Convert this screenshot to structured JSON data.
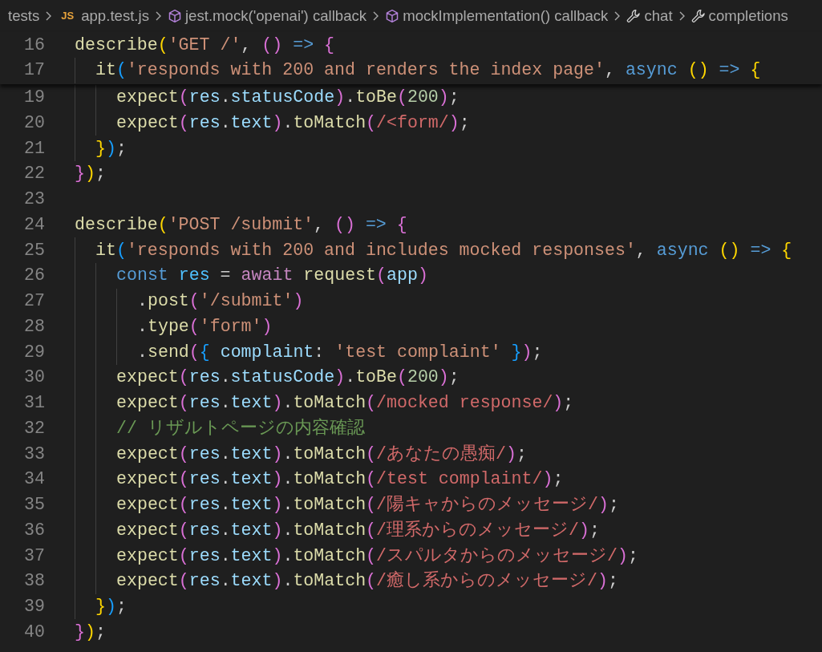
{
  "breadcrumbs": [
    {
      "kind": "folder",
      "label": "tests"
    },
    {
      "kind": "file",
      "badge": "JS",
      "label": "app.test.js"
    },
    {
      "kind": "function",
      "label": "jest.mock('openai') callback"
    },
    {
      "kind": "function",
      "label": "mockImplementation() callback"
    },
    {
      "kind": "property",
      "label": "chat"
    },
    {
      "kind": "property",
      "label": "completions"
    }
  ],
  "sticky_lines": [
    {
      "number": "16",
      "tokens": [
        {
          "kind": "fn",
          "text": "describe"
        },
        {
          "kind": "b1",
          "text": "("
        },
        {
          "kind": "str",
          "text": "'GET /'"
        },
        {
          "kind": "p",
          "text": ", "
        },
        {
          "kind": "b2",
          "text": "() "
        },
        {
          "kind": "kw",
          "text": "=> "
        },
        {
          "kind": "b2",
          "text": "{"
        }
      ]
    },
    {
      "number": "17",
      "tokens": [
        {
          "kind": "fn",
          "text": "  it"
        },
        {
          "kind": "b3",
          "text": "("
        },
        {
          "kind": "str",
          "text": "'responds with 200 and renders the index page'"
        },
        {
          "kind": "p",
          "text": ", "
        },
        {
          "kind": "kw",
          "text": "async "
        },
        {
          "kind": "b1",
          "text": "() "
        },
        {
          "kind": "kw",
          "text": "=> "
        },
        {
          "kind": "b1",
          "text": "{"
        }
      ]
    }
  ],
  "lines": [
    {
      "number": "19",
      "tokens": [
        {
          "kind": "fn",
          "text": "    expect"
        },
        {
          "kind": "b2",
          "text": "("
        },
        {
          "kind": "var",
          "text": "res"
        },
        {
          "kind": "p",
          "text": "."
        },
        {
          "kind": "var",
          "text": "statusCode"
        },
        {
          "kind": "b2",
          "text": ")"
        },
        {
          "kind": "p",
          "text": "."
        },
        {
          "kind": "fn",
          "text": "toBe"
        },
        {
          "kind": "b2",
          "text": "("
        },
        {
          "kind": "num",
          "text": "200"
        },
        {
          "kind": "b2",
          "text": ")"
        },
        {
          "kind": "p",
          "text": ";"
        }
      ]
    },
    {
      "number": "20",
      "tokens": [
        {
          "kind": "fn",
          "text": "    expect"
        },
        {
          "kind": "b2",
          "text": "("
        },
        {
          "kind": "var",
          "text": "res"
        },
        {
          "kind": "p",
          "text": "."
        },
        {
          "kind": "var",
          "text": "text"
        },
        {
          "kind": "b2",
          "text": ")"
        },
        {
          "kind": "p",
          "text": "."
        },
        {
          "kind": "fn",
          "text": "toMatch"
        },
        {
          "kind": "b2",
          "text": "("
        },
        {
          "kind": "re",
          "text": "/<form/"
        },
        {
          "kind": "b2",
          "text": ")"
        },
        {
          "kind": "p",
          "text": ";"
        }
      ]
    },
    {
      "number": "21",
      "tokens": [
        {
          "kind": "b1",
          "text": "  }"
        },
        {
          "kind": "b3",
          "text": ")"
        },
        {
          "kind": "p",
          "text": ";"
        }
      ]
    },
    {
      "number": "22",
      "tokens": [
        {
          "kind": "b2",
          "text": "}"
        },
        {
          "kind": "b1",
          "text": ")"
        },
        {
          "kind": "p",
          "text": ";"
        }
      ]
    },
    {
      "number": "23"
    },
    {
      "number": "24",
      "tokens": [
        {
          "kind": "fn",
          "text": "describe"
        },
        {
          "kind": "b1",
          "text": "("
        },
        {
          "kind": "str",
          "text": "'POST /submit'"
        },
        {
          "kind": "p",
          "text": ", "
        },
        {
          "kind": "b2",
          "text": "() "
        },
        {
          "kind": "kw",
          "text": "=> "
        },
        {
          "kind": "b2",
          "text": "{"
        }
      ]
    },
    {
      "number": "25",
      "tokens": [
        {
          "kind": "fn",
          "text": "  it"
        },
        {
          "kind": "b3",
          "text": "("
        },
        {
          "kind": "str",
          "text": "'responds with 200 and includes mocked responses'"
        },
        {
          "kind": "p",
          "text": ", "
        },
        {
          "kind": "kw",
          "text": "async "
        },
        {
          "kind": "b1",
          "text": "() "
        },
        {
          "kind": "kw",
          "text": "=> "
        },
        {
          "kind": "b1",
          "text": "{"
        }
      ]
    },
    {
      "number": "26",
      "tokens": [
        {
          "kind": "kw",
          "text": "    const "
        },
        {
          "kind": "const",
          "text": "res"
        },
        {
          "kind": "p",
          "text": " = "
        },
        {
          "kind": "ctrl",
          "text": "await "
        },
        {
          "kind": "fn",
          "text": "request"
        },
        {
          "kind": "b2",
          "text": "("
        },
        {
          "kind": "var",
          "text": "app"
        },
        {
          "kind": "b2",
          "text": ")"
        }
      ]
    },
    {
      "number": "27",
      "tokens": [
        {
          "kind": "p",
          "text": "      ."
        },
        {
          "kind": "fn",
          "text": "post"
        },
        {
          "kind": "b2",
          "text": "("
        },
        {
          "kind": "str",
          "text": "'/submit'"
        },
        {
          "kind": "b2",
          "text": ")"
        }
      ]
    },
    {
      "number": "28",
      "tokens": [
        {
          "kind": "p",
          "text": "      ."
        },
        {
          "kind": "fn",
          "text": "type"
        },
        {
          "kind": "b2",
          "text": "("
        },
        {
          "kind": "str",
          "text": "'form'"
        },
        {
          "kind": "b2",
          "text": ")"
        }
      ]
    },
    {
      "number": "29",
      "tokens": [
        {
          "kind": "p",
          "text": "      ."
        },
        {
          "kind": "fn",
          "text": "send"
        },
        {
          "kind": "b2",
          "text": "("
        },
        {
          "kind": "b3",
          "text": "{ "
        },
        {
          "kind": "var",
          "text": "complaint"
        },
        {
          "kind": "p",
          "text": ": "
        },
        {
          "kind": "str",
          "text": "'test complaint' "
        },
        {
          "kind": "b3",
          "text": "}"
        },
        {
          "kind": "b2",
          "text": ")"
        },
        {
          "kind": "p",
          "text": ";"
        }
      ]
    },
    {
      "number": "30",
      "tokens": [
        {
          "kind": "fn",
          "text": "    expect"
        },
        {
          "kind": "b2",
          "text": "("
        },
        {
          "kind": "var",
          "text": "res"
        },
        {
          "kind": "p",
          "text": "."
        },
        {
          "kind": "var",
          "text": "statusCode"
        },
        {
          "kind": "b2",
          "text": ")"
        },
        {
          "kind": "p",
          "text": "."
        },
        {
          "kind": "fn",
          "text": "toBe"
        },
        {
          "kind": "b2",
          "text": "("
        },
        {
          "kind": "num",
          "text": "200"
        },
        {
          "kind": "b2",
          "text": ")"
        },
        {
          "kind": "p",
          "text": ";"
        }
      ]
    },
    {
      "number": "31",
      "tokens": [
        {
          "kind": "fn",
          "text": "    expect"
        },
        {
          "kind": "b2",
          "text": "("
        },
        {
          "kind": "var",
          "text": "res"
        },
        {
          "kind": "p",
          "text": "."
        },
        {
          "kind": "var",
          "text": "text"
        },
        {
          "kind": "b2",
          "text": ")"
        },
        {
          "kind": "p",
          "text": "."
        },
        {
          "kind": "fn",
          "text": "toMatch"
        },
        {
          "kind": "b2",
          "text": "("
        },
        {
          "kind": "re",
          "text": "/mocked response/"
        },
        {
          "kind": "b2",
          "text": ")"
        },
        {
          "kind": "p",
          "text": ";"
        }
      ]
    },
    {
      "number": "32",
      "tokens": [
        {
          "kind": "cmt",
          "text": "    // リザルトページの内容確認"
        }
      ]
    },
    {
      "number": "33",
      "tokens": [
        {
          "kind": "fn",
          "text": "    expect"
        },
        {
          "kind": "b2",
          "text": "("
        },
        {
          "kind": "var",
          "text": "res"
        },
        {
          "kind": "p",
          "text": "."
        },
        {
          "kind": "var",
          "text": "text"
        },
        {
          "kind": "b2",
          "text": ")"
        },
        {
          "kind": "p",
          "text": "."
        },
        {
          "kind": "fn",
          "text": "toMatch"
        },
        {
          "kind": "b2",
          "text": "("
        },
        {
          "kind": "re",
          "text": "/あなたの愚痴/"
        },
        {
          "kind": "b2",
          "text": ")"
        },
        {
          "kind": "p",
          "text": ";"
        }
      ]
    },
    {
      "number": "34",
      "tokens": [
        {
          "kind": "fn",
          "text": "    expect"
        },
        {
          "kind": "b2",
          "text": "("
        },
        {
          "kind": "var",
          "text": "res"
        },
        {
          "kind": "p",
          "text": "."
        },
        {
          "kind": "var",
          "text": "text"
        },
        {
          "kind": "b2",
          "text": ")"
        },
        {
          "kind": "p",
          "text": "."
        },
        {
          "kind": "fn",
          "text": "toMatch"
        },
        {
          "kind": "b2",
          "text": "("
        },
        {
          "kind": "re",
          "text": "/test complaint/"
        },
        {
          "kind": "b2",
          "text": ")"
        },
        {
          "kind": "p",
          "text": ";"
        }
      ]
    },
    {
      "number": "35",
      "tokens": [
        {
          "kind": "fn",
          "text": "    expect"
        },
        {
          "kind": "b2",
          "text": "("
        },
        {
          "kind": "var",
          "text": "res"
        },
        {
          "kind": "p",
          "text": "."
        },
        {
          "kind": "var",
          "text": "text"
        },
        {
          "kind": "b2",
          "text": ")"
        },
        {
          "kind": "p",
          "text": "."
        },
        {
          "kind": "fn",
          "text": "toMatch"
        },
        {
          "kind": "b2",
          "text": "("
        },
        {
          "kind": "re",
          "text": "/陽キャからのメッセージ/"
        },
        {
          "kind": "b2",
          "text": ")"
        },
        {
          "kind": "p",
          "text": ";"
        }
      ]
    },
    {
      "number": "36",
      "tokens": [
        {
          "kind": "fn",
          "text": "    expect"
        },
        {
          "kind": "b2",
          "text": "("
        },
        {
          "kind": "var",
          "text": "res"
        },
        {
          "kind": "p",
          "text": "."
        },
        {
          "kind": "var",
          "text": "text"
        },
        {
          "kind": "b2",
          "text": ")"
        },
        {
          "kind": "p",
          "text": "."
        },
        {
          "kind": "fn",
          "text": "toMatch"
        },
        {
          "kind": "b2",
          "text": "("
        },
        {
          "kind": "re",
          "text": "/理系からのメッセージ/"
        },
        {
          "kind": "b2",
          "text": ")"
        },
        {
          "kind": "p",
          "text": ";"
        }
      ]
    },
    {
      "number": "37",
      "tokens": [
        {
          "kind": "fn",
          "text": "    expect"
        },
        {
          "kind": "b2",
          "text": "("
        },
        {
          "kind": "var",
          "text": "res"
        },
        {
          "kind": "p",
          "text": "."
        },
        {
          "kind": "var",
          "text": "text"
        },
        {
          "kind": "b2",
          "text": ")"
        },
        {
          "kind": "p",
          "text": "."
        },
        {
          "kind": "fn",
          "text": "toMatch"
        },
        {
          "kind": "b2",
          "text": "("
        },
        {
          "kind": "re",
          "text": "/スパルタからのメッセージ/"
        },
        {
          "kind": "b2",
          "text": ")"
        },
        {
          "kind": "p",
          "text": ";"
        }
      ]
    },
    {
      "number": "38",
      "tokens": [
        {
          "kind": "fn",
          "text": "    expect"
        },
        {
          "kind": "b2",
          "text": "("
        },
        {
          "kind": "var",
          "text": "res"
        },
        {
          "kind": "p",
          "text": "."
        },
        {
          "kind": "var",
          "text": "text"
        },
        {
          "kind": "b2",
          "text": ")"
        },
        {
          "kind": "p",
          "text": "."
        },
        {
          "kind": "fn",
          "text": "toMatch"
        },
        {
          "kind": "b2",
          "text": "("
        },
        {
          "kind": "re",
          "text": "/癒し系からのメッセージ/"
        },
        {
          "kind": "b2",
          "text": ")"
        },
        {
          "kind": "p",
          "text": ";"
        }
      ]
    },
    {
      "number": "39",
      "tokens": [
        {
          "kind": "b1",
          "text": "  }"
        },
        {
          "kind": "b3",
          "text": ")"
        },
        {
          "kind": "p",
          "text": ";"
        }
      ]
    },
    {
      "number": "40",
      "tokens": [
        {
          "kind": "b2",
          "text": "}"
        },
        {
          "kind": "b1",
          "text": ")"
        },
        {
          "kind": "p",
          "text": ";"
        }
      ]
    }
  ]
}
